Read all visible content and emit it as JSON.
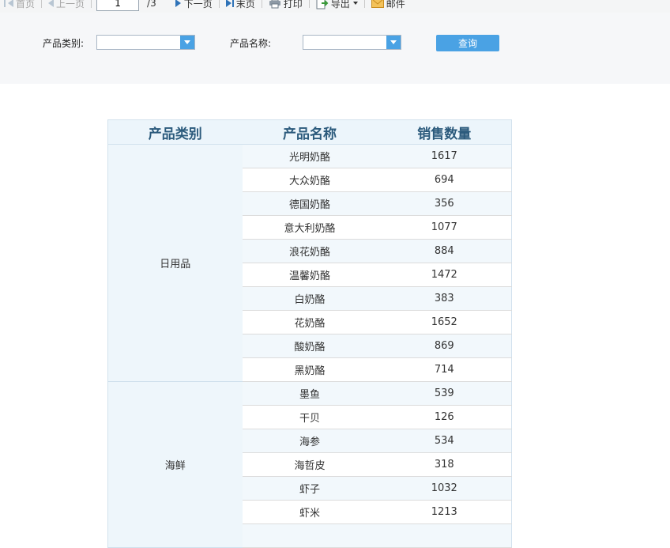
{
  "toolbar": {
    "first": "首页",
    "prev": "上一页",
    "page_value": "1",
    "total": "/3",
    "next": "下一页",
    "last": "末页",
    "print": "打印",
    "export": "导出",
    "mail": "邮件"
  },
  "filter": {
    "category_label": "产品类别:",
    "category_value": "",
    "name_label": "产品名称:",
    "name_value": "",
    "query_label": "查询"
  },
  "table": {
    "headers": [
      "产品类别",
      "产品名称",
      "销售数量"
    ],
    "groups": [
      {
        "category": "日用品",
        "rows": [
          {
            "name": "光明奶酪",
            "qty": "1617"
          },
          {
            "name": "大众奶酪",
            "qty": "694"
          },
          {
            "name": "德国奶酪",
            "qty": "356"
          },
          {
            "name": "意大利奶酪",
            "qty": "1077"
          },
          {
            "name": "浪花奶酪",
            "qty": "884"
          },
          {
            "name": "温馨奶酪",
            "qty": "1472"
          },
          {
            "name": "白奶酪",
            "qty": "383"
          },
          {
            "name": "花奶酪",
            "qty": "1652"
          },
          {
            "name": "酸奶酪",
            "qty": "869"
          },
          {
            "name": "黑奶酪",
            "qty": "714"
          }
        ]
      },
      {
        "category": "海鲜",
        "rows": [
          {
            "name": "墨鱼",
            "qty": "539"
          },
          {
            "name": "干贝",
            "qty": "126"
          },
          {
            "name": "海参",
            "qty": "534"
          },
          {
            "name": "海哲皮",
            "qty": "318"
          },
          {
            "name": "虾子",
            "qty": "1032"
          },
          {
            "name": "虾米",
            "qty": "1213"
          }
        ]
      }
    ]
  },
  "colors": {
    "accent": "#4aa2e4",
    "header_text": "#2b5a7c",
    "header_bg": "#ecf5fb",
    "row_alt_bg": "#f2f8fc"
  }
}
